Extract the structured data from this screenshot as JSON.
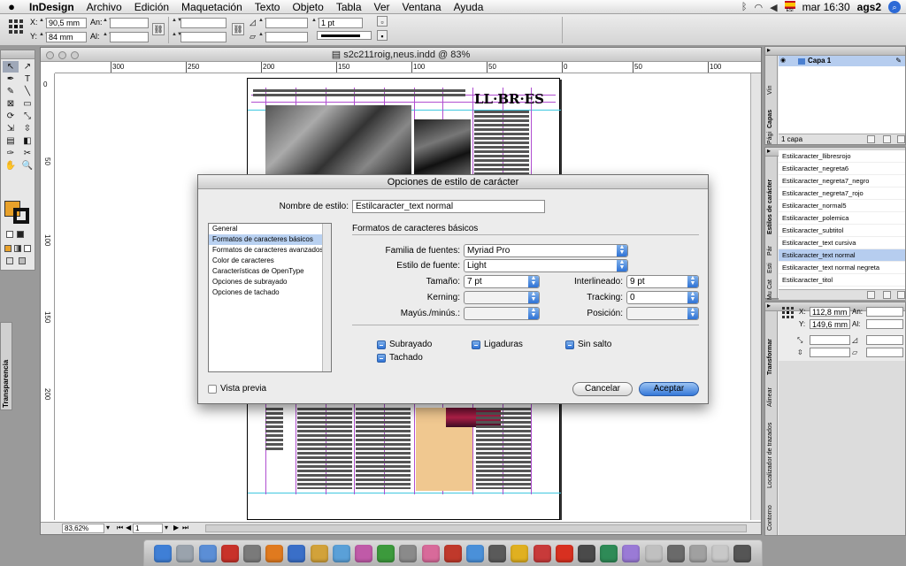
{
  "menubar": {
    "apple": "",
    "items": [
      "InDesign",
      "Archivo",
      "Edición",
      "Maquetación",
      "Texto",
      "Objeto",
      "Tabla",
      "Ver",
      "Ventana",
      "Ayuda"
    ],
    "clock": "mar 16:30",
    "user": "ags2",
    "flag_label": "ESI"
  },
  "controlbar": {
    "x_label": "X:",
    "x_value": "90,5 mm",
    "y_label": "Y:",
    "y_value": "84 mm",
    "w_label": "An:",
    "h_label": "Al:",
    "stroke_weight": "1 pt"
  },
  "tools": {
    "items": [
      "↖",
      "↗",
      "✒",
      "T",
      "✎",
      "╲",
      "⊠",
      "▭",
      "⟳",
      "⤡",
      "⇲",
      "⇳",
      "▤",
      "◧",
      "✑",
      "✂",
      "✋",
      "🔍"
    ],
    "colors": {
      "fill": "#e8a12a",
      "stroke": "#111111"
    }
  },
  "transparency_tab": {
    "label": "Transparencia"
  },
  "document": {
    "title": "s2c211roig,neus.indd @ 83%",
    "zoom": "83,62%",
    "page": "1",
    "ruler_h": [
      "300",
      "250",
      "200",
      "150",
      "100",
      "50",
      "0",
      "50",
      "100"
    ],
    "ruler_v": [
      "0",
      "50",
      "100",
      "150",
      "200"
    ],
    "logo": "LL·BR·ES"
  },
  "dialog": {
    "title": "Opciones de estilo de carácter",
    "style_name_label": "Nombre de estilo:",
    "style_name_value": "Estilcaracter_text normal",
    "categories": [
      "General",
      "Formatos de caracteres básicos",
      "Formatos de caracteres avanzados",
      "Color de caracteres",
      "Características de OpenType",
      "Opciones de subrayado",
      "Opciones de tachado"
    ],
    "selected_category": 1,
    "section_title": "Formatos de caracteres básicos",
    "font_family_label": "Familia de fuentes:",
    "font_family_value": "Myriad Pro",
    "font_style_label": "Estilo de fuente:",
    "font_style_value": "Light",
    "size_label": "Tamaño:",
    "size_value": "7 pt",
    "leading_label": "Interlineado:",
    "leading_value": "9 pt",
    "kerning_label": "Kerning:",
    "kerning_value": "",
    "tracking_label": "Tracking:",
    "tracking_value": "0",
    "case_label": "Mayús./minús.:",
    "case_value": "",
    "position_label": "Posición:",
    "position_value": "",
    "underline_label": "Subrayado",
    "ligatures_label": "Ligaduras",
    "nobreak_label": "Sin salto",
    "strikethrough_label": "Tachado",
    "preview_label": "Vista previa",
    "cancel_label": "Cancelar",
    "ok_label": "Aceptar"
  },
  "layers_panel": {
    "tabs": [
      "Capas",
      "Vín",
      "Pági"
    ],
    "layer_name": "Capa 1",
    "footer": "1 capa"
  },
  "char_styles_panel": {
    "tabs": [
      "Estilos de carácter",
      "Pár",
      "Esti",
      "Mu",
      "Cat"
    ],
    "items": [
      "Estilcaracter_llibresrojo",
      "Estilcaracter_negreta6",
      "Estilcaracter_negreta7_negro",
      "Estilcaracter_negreta7_rojo",
      "Estilcaracter_normal5",
      "Estilcaracter_polemica",
      "Estilcaracter_subtitol",
      "Estilcaracter_text cursiva",
      "Estilcaracter_text normal",
      "Estilcaracter_text normal negreta",
      "Estilcaracter_titol"
    ],
    "selected": 8
  },
  "transform_panel": {
    "tabs": [
      "Transformar",
      "Alinear",
      "Localizador de trazados",
      "Contorno"
    ],
    "x_label": "X:",
    "x_value": "112,8 mm",
    "y_label": "Y:",
    "y_value": "149,6 mm",
    "w_label": "An:",
    "h_label": "Al:"
  },
  "dock": {
    "colors": [
      "#3f7fd6",
      "#9aa3ad",
      "#5b8ed6",
      "#c8322a",
      "#7a7a7a",
      "#e07a1f",
      "#3a6fc8",
      "#d2a23a",
      "#5aa0d8",
      "#c05aa8",
      "#3c9a3c",
      "#8a8a8a",
      "#d86a9a",
      "#c0392b",
      "#4a90d9",
      "#5a5a5a",
      "#e0b020",
      "#c83a3a",
      "#d83020",
      "#4a4a4a",
      "#2e8b57",
      "#9a7ad6",
      "#c0c0c0",
      "#6a6a6a",
      "#a0a0a0",
      "#c8c8c8",
      "#555555"
    ]
  }
}
